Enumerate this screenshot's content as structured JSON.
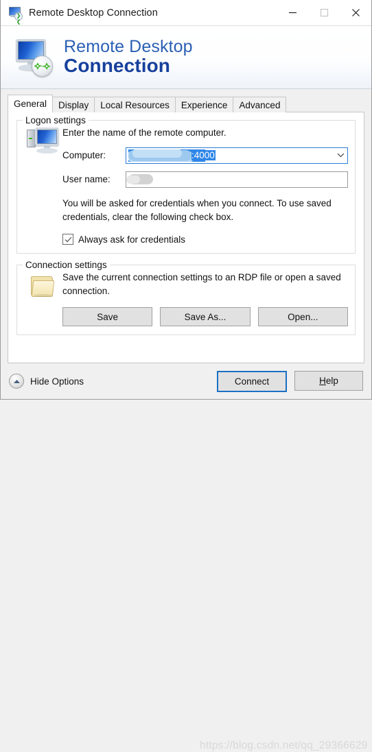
{
  "window": {
    "title": "Remote Desktop Connection",
    "icon": "remote-desktop-icon",
    "minimize_label": "—",
    "maximize_label": "□",
    "close_label": "✕"
  },
  "banner": {
    "line1": "Remote Desktop",
    "line2": "Connection",
    "logo_badge": "⟣⟢"
  },
  "tabs": [
    {
      "label": "General",
      "active": true
    },
    {
      "label": "Display",
      "active": false
    },
    {
      "label": "Local Resources",
      "active": false
    },
    {
      "label": "Experience",
      "active": false
    },
    {
      "label": "Advanced",
      "active": false
    }
  ],
  "logon_settings": {
    "group_title": "Logon settings",
    "description": "Enter the name of the remote computer.",
    "computer_label": "Computer:",
    "computer_value": ":4000",
    "computer_value_redacted": true,
    "user_name_label": "User name:",
    "user_name_value": "",
    "user_name_redacted": true,
    "credentials_note": "You will be asked for credentials when you connect. To use saved credentials, clear the following check box.",
    "always_ask_label": "Always ask for credentials",
    "always_ask_checked": true
  },
  "connection_settings": {
    "group_title": "Connection settings",
    "description": "Save the current connection settings to an RDP file or open a saved connection.",
    "buttons": [
      {
        "label": "Save"
      },
      {
        "label": "Save As..."
      },
      {
        "label": "Open..."
      }
    ]
  },
  "footer": {
    "hide_options_label": "Hide Options",
    "connect_label": "Connect",
    "help_label_prefix": "",
    "help_label_accel": "H",
    "help_label_rest": "elp"
  },
  "watermark": {
    "text": "https://blog.csdn.net/qq_29366629"
  },
  "colors": {
    "accent": "#2a7fd4",
    "banner_title": "#2a5fb4",
    "banner_bold": "#17409c",
    "selection": "#2f86e8",
    "window_bg": "#f0f0f0"
  }
}
